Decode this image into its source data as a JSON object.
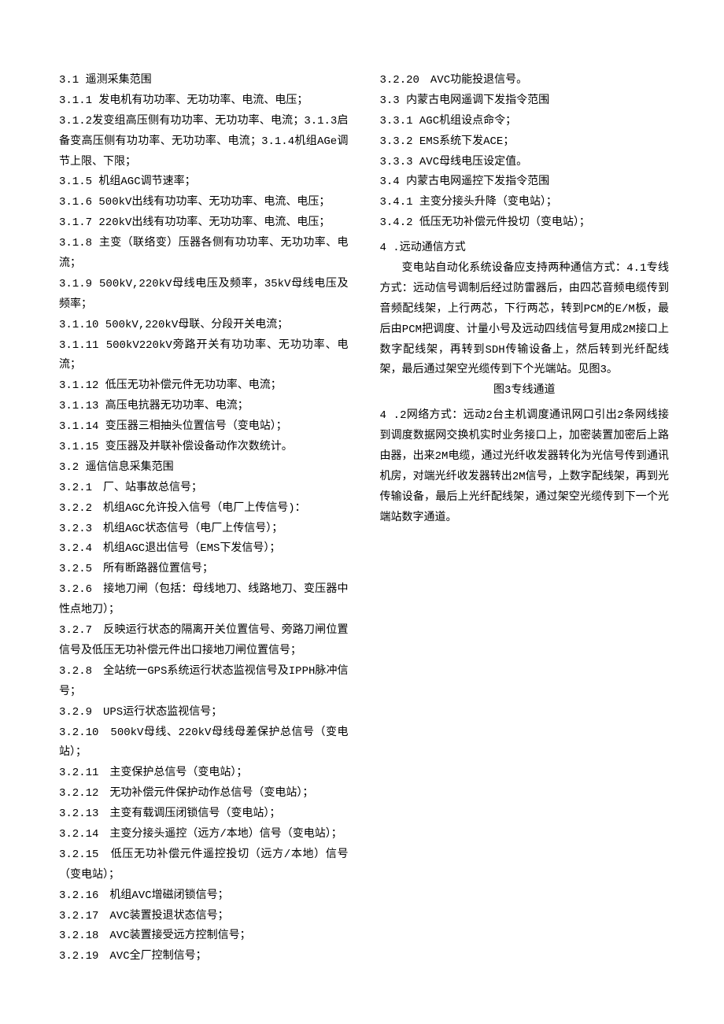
{
  "col1": {
    "s31_title": "3.1 遥测采集范围",
    "s311": "3.1.1 发电机有功功率、无功功率、电流、电压；",
    "s312_314": "3.1.2发变组高压侧有功功率、无功功率、电流；3.1.3启备变高压侧有功功率、无功功率、电流；3.1.4机组AGe调节上限、下限；",
    "s315": "3.1.5 机组AGC调节速率；",
    "s316": "3.1.6 500kV出线有功功率、无功功率、电流、电压；",
    "s317": "3.1.7 220kV出线有功功率、无功功率、电流、电压；",
    "s318": "3.1.8 主变（联络变）压器各侧有功功率、无功功率、电流；",
    "s319": "3.1.9 500kV,220kV母线电压及频率，35kV母线电压及频率；",
    "s3110": "3.1.10 500kV,220kV母联、分段开关电流；",
    "s3111": "3.1.11 500kV220kV旁路开关有功功率、无功功率、电流；",
    "s3112": "3.1.12 低压无功补偿元件无功功率、电流；",
    "s3113": "3.1.13 高压电抗器无功功率、电流；",
    "s3114": "3.1.14 变压器三相抽头位置信号（变电站）；",
    "s3115": "3.1.15 变压器及并联补偿设备动作次数统计。",
    "s32_title": "3.2 遥信信息采集范围",
    "s321": "3.2.1　厂、站事故总信号；",
    "s322": "3.2.2　机组AGC允许投入信号（电厂上传信号)：",
    "s323": "3.2.3　机组AGC状态信号（电厂上传信号）；",
    "s324": "3.2.4　机组AGC退出信号（EMS下发信号）；",
    "s325": "3.2.5　所有断路器位置信号；",
    "s326": "3.2.6　接地刀闸（包括：母线地刀、线路地刀、变压器中性点地刀）；",
    "s327": "3.2.7　反映运行状态的隔离开关位置信号、旁路刀闸位置信号及低压无功补偿元件出口接地刀闸位置信号；",
    "s328": "3.2.8　全站统一GPS系统运行状态监视信号及IPPH脉冲信号；",
    "s329": "3.2.9　UPS运行状态监视信号；",
    "s3210": "3.2.10　500kV母线、220kV母线母差保护总信号（变电站）；",
    "s3211": "3.2.11　主变保护总信号（变电站）；",
    "s3212": "3.2.12　无功补偿元件保护动作总信号（变电站）；",
    "s3213": "3.2.13　主变有载调压闭锁信号（变电站）；",
    "s3214": "3.2.14　主变分接头遥控（远方/本地）信号（变电站）；",
    "s3215": "3.2.15　低压无功补偿元件遥控投切（远方/本地）信号　（变电站）；",
    "s3216": "3.2.16　机组AVC增磁闭锁信号；",
    "s3217": "3.2.17　AVC装置投退状态信号；",
    "s3218": "3.2.18　AVC装置接受远方控制信号；"
  },
  "col2": {
    "s3219": "3.2.19　AVC全厂控制信号；",
    "s3220": "3.2.20　AVC功能投退信号。",
    "s33_title": "3.3 内蒙古电网遥调下发指令范围",
    "s331": "3.3.1 AGC机组设点命令；",
    "s332": "3.3.2 EMS系统下发ACE；",
    "s333": "3.3.3 AVC母线电压设定值。",
    "s34_title": "3.4 内蒙古电网遥控下发指令范围",
    "s341": "3.4.1 主变分接头升降（变电站）；",
    "s342": "3.4.2 低压无功补偿元件投切（变电站）；",
    "s4_title": "4 .远动通信方式",
    "s4p1": "变电站自动化系统设备应支持两种通信方式：4.1专线方式：远动信号调制后经过防雷器后，由四芯音频电缆传到音频配线架，上行两芯，下行两芯，转到PCM的E/M板，最后由PCM把调度、计量小号及远动四线信号复用成2M接口上数字配线架，再转到SDH传输设备上，然后转到光纤配线架，最后通过架空光缆传到下个光端站。见图3。",
    "fig3": "图3专线通道",
    "s42": "4 .2网络方式：远动2台主机调度通讯网口引出2条网线接到调度数据网交换机实时业务接口上，加密装置加密后上路由器，出来2M电缆，通过光纤收发器转化为光信号传到通讯机房，对端光纤收发器转出2M信号，上数字配线架，再到光传输设备，最后上光纤配线架，通过架空光缆传到下一个光端站数字通道。"
  }
}
